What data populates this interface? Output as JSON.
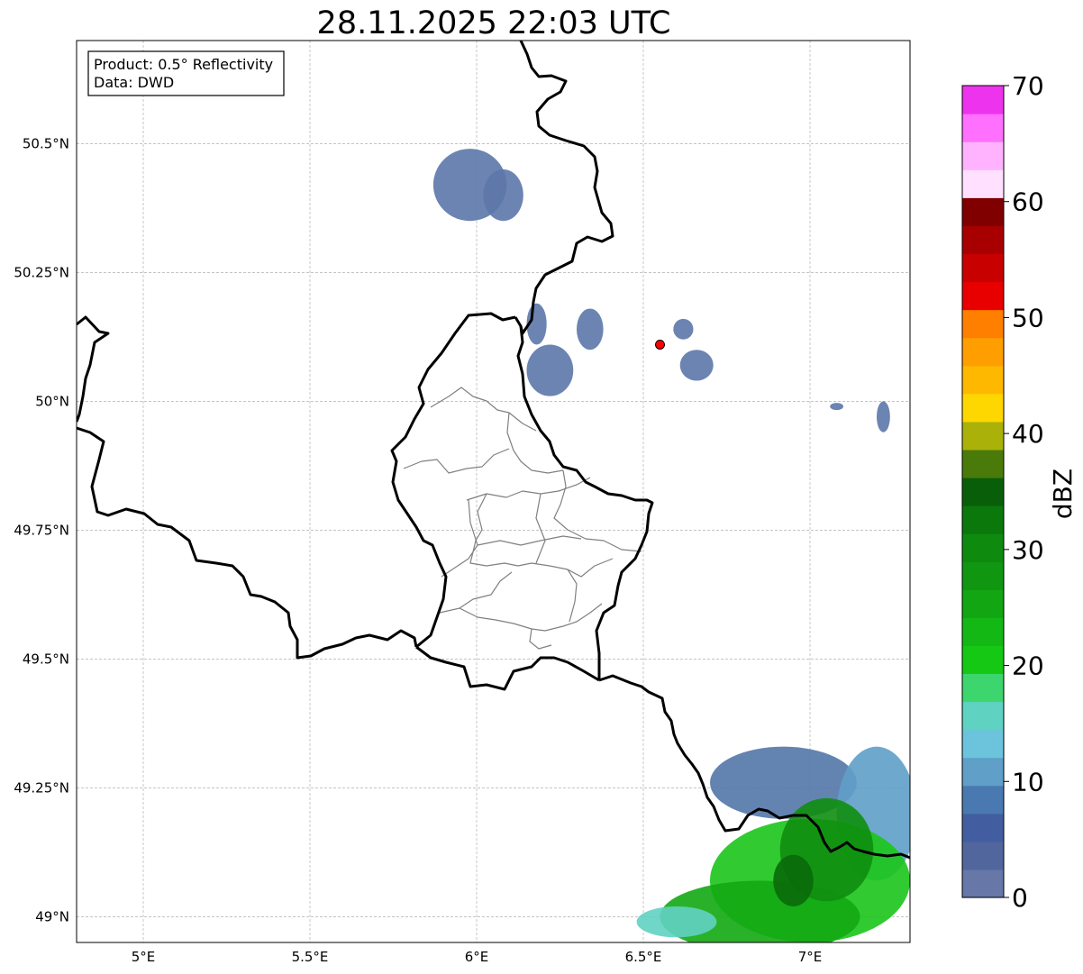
{
  "title": "28.11.2025 22:03 UTC",
  "info_box": {
    "product_line": "Product: 0.5° Reflectivity",
    "data_line": "Data: DWD"
  },
  "map": {
    "lon_range": [
      4.8,
      7.3
    ],
    "lat_range": [
      48.95,
      50.7
    ],
    "x_ticks": [
      {
        "value": 5.0,
        "label": "5°E"
      },
      {
        "value": 5.5,
        "label": "5.5°E"
      },
      {
        "value": 6.0,
        "label": "6°E"
      },
      {
        "value": 6.5,
        "label": "6.5°E"
      },
      {
        "value": 7.0,
        "label": "7°E"
      }
    ],
    "y_ticks": [
      {
        "value": 49.0,
        "label": "49°N"
      },
      {
        "value": 49.25,
        "label": "49.25°N"
      },
      {
        "value": 49.5,
        "label": "49.5°N"
      },
      {
        "value": 49.75,
        "label": "49.75°N"
      },
      {
        "value": 50.0,
        "label": "50°N"
      },
      {
        "value": 50.25,
        "label": "50.25°N"
      },
      {
        "value": 50.5,
        "label": "50.5°N"
      }
    ],
    "grid": true,
    "radar_site": {
      "lon": 6.55,
      "lat": 50.11,
      "color": "#ff0000"
    },
    "echo_cells": [
      {
        "lon": 5.98,
        "lat": 50.42,
        "rlon": 0.11,
        "rlat": 0.07,
        "color": "#5c77a8"
      },
      {
        "lon": 6.08,
        "lat": 50.4,
        "rlon": 0.06,
        "rlat": 0.05,
        "color": "#5c77a8"
      },
      {
        "lon": 6.22,
        "lat": 50.06,
        "rlon": 0.07,
        "rlat": 0.05,
        "color": "#5c77a8"
      },
      {
        "lon": 6.18,
        "lat": 50.15,
        "rlon": 0.03,
        "rlat": 0.04,
        "color": "#5c77a8"
      },
      {
        "lon": 6.34,
        "lat": 50.14,
        "rlon": 0.04,
        "rlat": 0.04,
        "color": "#5c77a8"
      },
      {
        "lon": 6.66,
        "lat": 50.07,
        "rlon": 0.05,
        "rlat": 0.03,
        "color": "#5c77a8"
      },
      {
        "lon": 6.62,
        "lat": 50.14,
        "rlon": 0.03,
        "rlat": 0.02,
        "color": "#5c77a8"
      },
      {
        "lon": 7.22,
        "lat": 49.97,
        "rlon": 0.02,
        "rlat": 0.03,
        "color": "#5c77a8"
      },
      {
        "lon": 7.08,
        "lat": 49.99,
        "rlon": 0.02,
        "rlat": 0.007,
        "color": "#5c77a8"
      },
      {
        "lon": 6.92,
        "lat": 49.26,
        "rlon": 0.22,
        "rlat": 0.07,
        "color": "#5277a8"
      },
      {
        "lon": 7.2,
        "lat": 49.2,
        "rlon": 0.12,
        "rlat": 0.13,
        "color": "#5f9fc8"
      },
      {
        "lon": 7.0,
        "lat": 49.07,
        "rlon": 0.3,
        "rlat": 0.12,
        "color": "#1bc51b"
      },
      {
        "lon": 6.85,
        "lat": 49.0,
        "rlon": 0.3,
        "rlat": 0.07,
        "color": "#13a813"
      },
      {
        "lon": 7.05,
        "lat": 49.13,
        "rlon": 0.14,
        "rlat": 0.1,
        "color": "#0f8e0f"
      },
      {
        "lon": 6.95,
        "lat": 49.07,
        "rlon": 0.06,
        "rlat": 0.05,
        "color": "#0a6a0a"
      },
      {
        "lon": 6.6,
        "lat": 48.99,
        "rlon": 0.12,
        "rlat": 0.03,
        "color": "#60d2c2"
      }
    ]
  },
  "colorbar": {
    "label": "dBZ",
    "ticks": [
      "0",
      "10",
      "20",
      "30",
      "40",
      "50",
      "60",
      "70"
    ],
    "min": 0,
    "max": 70,
    "colors": [
      "#6677a8",
      "#52669e",
      "#435ea0",
      "#4a78b0",
      "#5f9fc8",
      "#6cc4dc",
      "#60d2c2",
      "#3dd66e",
      "#14c814",
      "#14b814",
      "#12a612",
      "#109610",
      "#0e8a0e",
      "#0b780b",
      "#095e09",
      "#4a7a0a",
      "#aab20a",
      "#ffd700",
      "#ffb800",
      "#ff9e00",
      "#ff7f00",
      "#e80000",
      "#c80000",
      "#a80000",
      "#800000",
      "#ffe0ff",
      "#ffb3ff",
      "#ff70ff",
      "#ee33ee"
    ]
  }
}
